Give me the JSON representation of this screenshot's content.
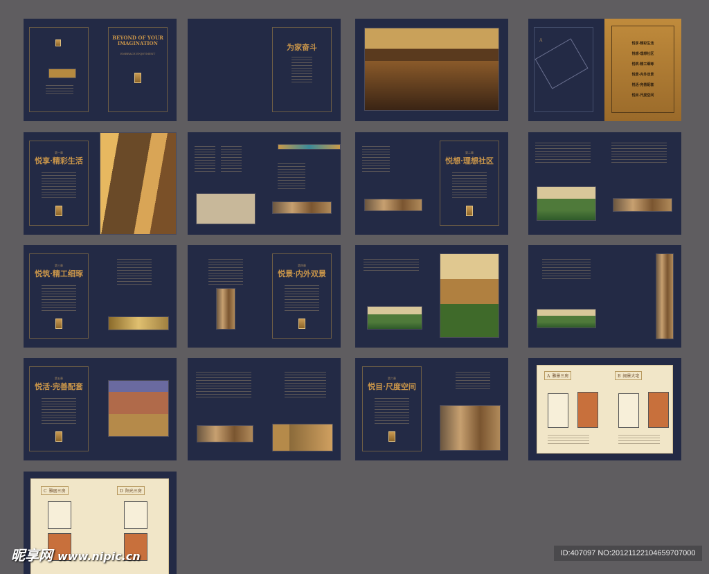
{
  "colors": {
    "background": "#5f5d60",
    "page_navy": "#232a45",
    "accent_gold": "#c9954a"
  },
  "cover": {
    "headline": "BEYOND OF YOUR IMAGINATION",
    "tagline": "EMBRACE ENJOYMENT"
  },
  "intro": {
    "title": "为家奋斗"
  },
  "contents": {
    "marker": "A",
    "items": [
      "悦享·精彩生活",
      "悦想·理想社区",
      "悦筑·精工细琢",
      "悦景·内外双景",
      "悦活·完善配套",
      "悦目·尺度空间"
    ]
  },
  "chapters": {
    "ch1": {
      "number": "第一章",
      "title": "悦享·精彩生活"
    },
    "ch2": {
      "number": "第二章",
      "title": "悦想·理想社区"
    },
    "ch3": {
      "number": "第三章",
      "title": "悦筑·精工细琢"
    },
    "ch4": {
      "number": "第四章",
      "title": "悦景·内外双景"
    },
    "ch5": {
      "number": "第五章",
      "title": "悦活·完善配套"
    },
    "ch6": {
      "number": "第六章",
      "title": "悦目·尺度空间"
    }
  },
  "floorplans": [
    {
      "letter": "A",
      "name": "雅景三房"
    },
    {
      "letter": "B",
      "name": "阔景大宅"
    },
    {
      "letter": "C",
      "name": "雅居三房"
    },
    {
      "letter": "D",
      "name": "阳光三房"
    }
  ],
  "watermark": {
    "logo": "昵享网",
    "url": "www.nipic.cn"
  },
  "image_id": "ID:407097 NO:20121122104659707000"
}
